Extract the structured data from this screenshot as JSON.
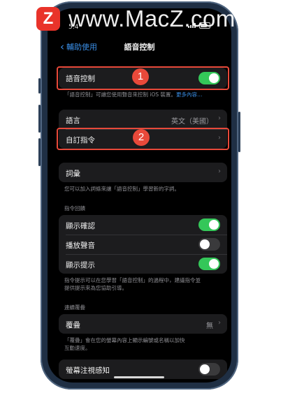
{
  "watermark": {
    "logo_letter": "Z",
    "text": "www.MacZ.com"
  },
  "colors": {
    "accent": "#3a8ee6",
    "toggle_on": "#34c759",
    "highlight": "#e8493a"
  },
  "status_bar": {
    "time": "5:4"
  },
  "nav": {
    "back_label": "輔助使用",
    "title": "語音控制"
  },
  "voice_control": {
    "label": "語音控制",
    "toggle": true,
    "badge": "1",
    "footer": "「語音控制」可讓您使用聲音來控制 iOS 裝置。",
    "footer_link": "更多內容…"
  },
  "language": {
    "label": "語言",
    "value": "英文（美國）"
  },
  "custom_commands": {
    "label": "自訂指令",
    "badge": "2"
  },
  "vocabulary": {
    "label": "詞彙",
    "footer": "您可以加入詞條來讓「語音控制」學習新的字詞。"
  },
  "command_feedback": {
    "header": "指令回饋",
    "items": [
      {
        "label": "顯示確認",
        "on": true
      },
      {
        "label": "播放聲音",
        "on": false
      },
      {
        "label": "顯示提示",
        "on": true
      }
    ],
    "footer_line1": "指令提示可以在您學習「語音控制」的過程中，建議指令並",
    "footer_line2": "提供提示來為您協助引導。"
  },
  "continuous_overlay": {
    "header": "連續覆疊",
    "label": "覆疊",
    "value": "無",
    "footer_line1": "「覆疊」會在您的螢幕內容上顯示編號或名稱以加快",
    "footer_line2": "互動速度。"
  },
  "attention": {
    "label": "螢幕注視感知",
    "on": false
  }
}
